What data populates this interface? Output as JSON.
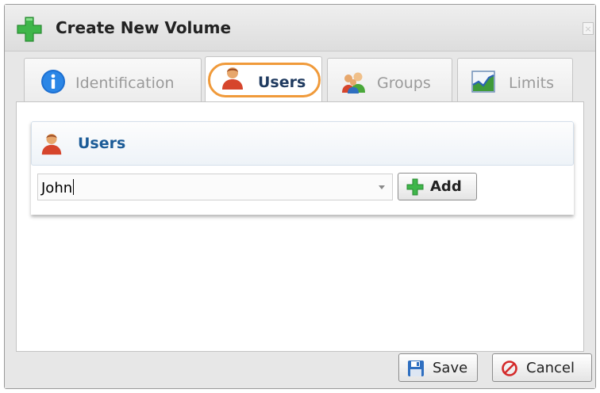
{
  "window": {
    "title": "Create New Volume",
    "close_glyph": "×"
  },
  "tabs": [
    {
      "label": "Identification",
      "icon": "info-icon",
      "active": false
    },
    {
      "label": "Users",
      "icon": "user-icon",
      "active": true
    },
    {
      "label": "Groups",
      "icon": "group-icon",
      "active": false
    },
    {
      "label": "Limits",
      "icon": "chart-icon",
      "active": false
    }
  ],
  "panel": {
    "title": "Users",
    "user_select": {
      "value": "John"
    },
    "add_label": "Add"
  },
  "footer": {
    "save_label": "Save",
    "cancel_label": "Cancel"
  },
  "colors": {
    "accent_blue": "#1b5b97",
    "highlight_orange": "#f09a3a",
    "plus_green": "#3fb64a"
  }
}
